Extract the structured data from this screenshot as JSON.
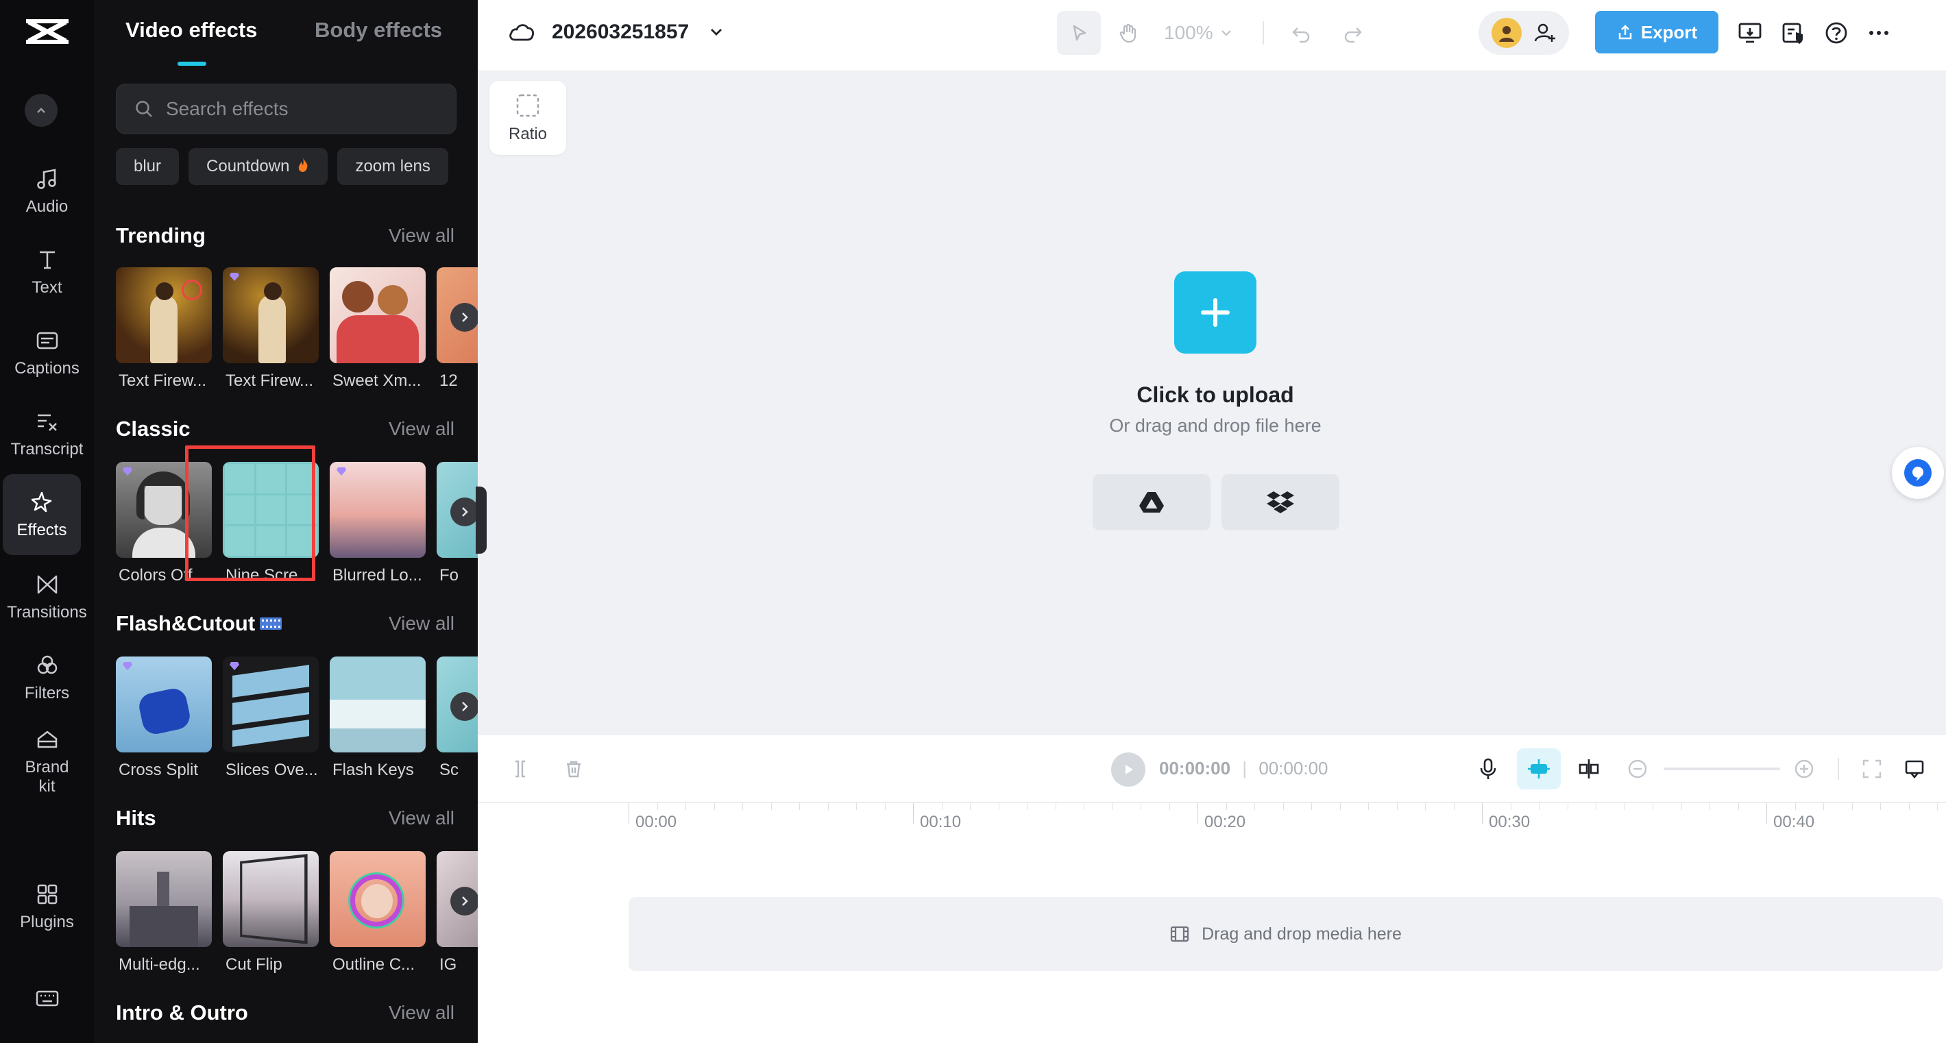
{
  "rail": {
    "items": [
      {
        "label": "Audio",
        "icon": "music-note-icon"
      },
      {
        "label": "Text",
        "icon": "text-icon"
      },
      {
        "label": "Captions",
        "icon": "captions-icon"
      },
      {
        "label": "Transcript",
        "icon": "transcript-icon"
      },
      {
        "label": "Effects",
        "icon": "effects-sparkle-icon",
        "active": true
      },
      {
        "label": "Transitions",
        "icon": "transitions-icon"
      },
      {
        "label": "Filters",
        "icon": "filters-icon"
      },
      {
        "label": "Brand\nkit",
        "icon": "brand-kit-icon"
      },
      {
        "label": "Plugins",
        "icon": "plugins-grid-icon"
      }
    ]
  },
  "panel": {
    "tabs": [
      "Video effects",
      "Body effects"
    ],
    "search_placeholder": "Search effects",
    "chips": [
      "blur",
      "Countdown",
      "zoom lens"
    ],
    "sections": [
      {
        "title": "Trending",
        "view_all": "View all",
        "cards": [
          "Text Firew...",
          "Text Firew...",
          "Sweet Xm...",
          "12"
        ]
      },
      {
        "title": "Classic",
        "view_all": "View all",
        "cards": [
          "Colors Off",
          "Nine Scre...",
          "Blurred Lo...",
          "Fo"
        ]
      },
      {
        "title": "Flash&Cutout",
        "view_all": "View all",
        "cards": [
          "Cross Split",
          "Slices Ove...",
          "Flash Keys",
          "Sc"
        ]
      },
      {
        "title": "Hits",
        "view_all": "View all",
        "cards": [
          "Multi-edg...",
          "Cut Flip",
          "Outline C...",
          "IG"
        ]
      },
      {
        "title": "Intro & Outro",
        "view_all": "View all",
        "cards": []
      }
    ]
  },
  "topbar": {
    "project_name": "202603251857",
    "zoom": "100%",
    "export_label": "Export"
  },
  "canvas": {
    "ratio_label": "Ratio",
    "upload_title": "Click to upload",
    "upload_subtitle": "Or drag and drop file here"
  },
  "timeline": {
    "current_time": "00:00:00",
    "total_time": "00:00:00",
    "ruler": [
      "00:00",
      "00:10",
      "00:20",
      "00:30",
      "00:40"
    ],
    "dropzone_text": "Drag and drop media here"
  },
  "colors": {
    "accent": "#1fbfe8",
    "export": "#3aa0ec",
    "highlight": "#f0403c"
  }
}
